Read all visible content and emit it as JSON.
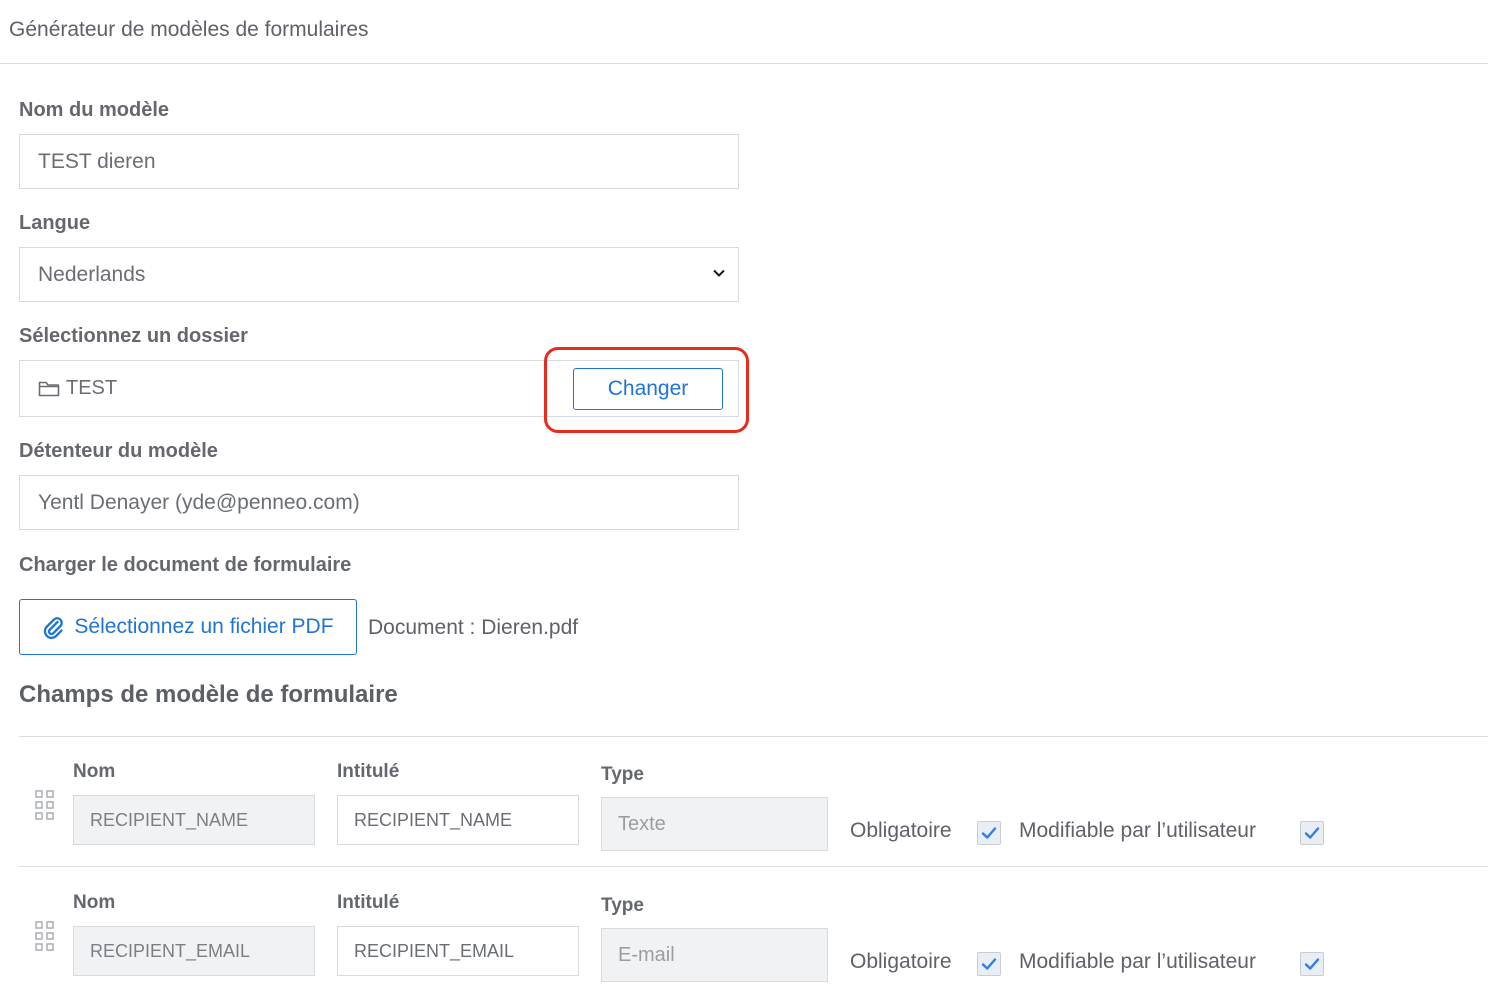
{
  "header": {
    "title": "Générateur de modèles de formulaires"
  },
  "form": {
    "template_name": {
      "label": "Nom du modèle",
      "value": "TEST dieren"
    },
    "language": {
      "label": "Langue",
      "value": "Nederlands"
    },
    "folder": {
      "label": "Sélectionnez un dossier",
      "value": "TEST",
      "change_label": "Changer"
    },
    "owner": {
      "label": "Détenteur du modèle",
      "value": "Yentl Denayer (yde@penneo.com)"
    },
    "upload": {
      "label": "Charger le document de formulaire",
      "button_label": "Sélectionnez un fichier PDF",
      "document_text": "Document : Dieren.pdf"
    }
  },
  "fields_section": {
    "title": "Champs de modèle de formulaire",
    "columns": {
      "name": "Nom",
      "title": "Intitulé",
      "type": "Type",
      "required": "Obligatoire",
      "editable": "Modifiable par l’utilisateur"
    },
    "rows": [
      {
        "name": "RECIPIENT_NAME",
        "title": "RECIPIENT_NAME",
        "type": "Texte",
        "required": true,
        "editable": true
      },
      {
        "name": "RECIPIENT_EMAIL",
        "title": "RECIPIENT_EMAIL",
        "type": "E-mail",
        "required": true,
        "editable": true
      }
    ]
  },
  "colors": {
    "accent": "#1f74d6",
    "highlight": "#e62c1e",
    "checkmark": "#2f7ee0"
  },
  "icons": {
    "folder": "folder-icon",
    "select": "chevron-down-icon",
    "attach": "paperclip-icon",
    "drag": "drag-handle-icon",
    "check": "check-icon"
  }
}
